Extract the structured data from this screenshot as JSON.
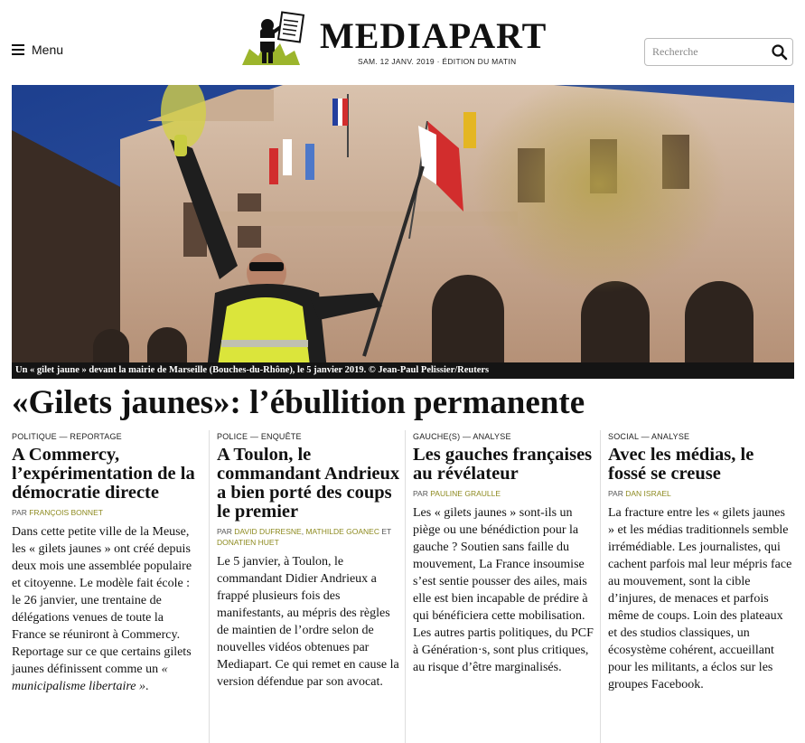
{
  "header": {
    "menu_label": "Menu",
    "logo_text": "MEDIAPART",
    "date_line": "SAM. 12 JANV. 2019 · ÉDITION DU MATIN",
    "search_placeholder": "Recherche"
  },
  "hero": {
    "caption": "Un « gilet jaune » devant la mairie de Marseille (Bouches-du-Rhône), le 5 janvier 2019. © Jean-Paul Pelissier/Reuters"
  },
  "headline": "«Gilets jaunes»: l’ébullition permanente",
  "articles": [
    {
      "rubric": "POLITIQUE — REPORTAGE",
      "title": "A Commercy, l’expérimentation de la démocratie directe",
      "by": "PAR",
      "authors": [
        "FRANÇOIS BONNET"
      ],
      "body": "Dans cette petite ville de la Meuse, les « gilets jaunes » ont créé depuis deux mois une assemblée populaire et citoyenne. Le modèle fait école : le 26 janvier, une trentaine de délégations venues de toute la France se réuniront à Commercy. Reportage sur ce que certains gilets jaunes définissent comme un",
      "body_em": "« municipalisme libertaire »",
      "body_end": "."
    },
    {
      "rubric": "POLICE — ENQUÊTE",
      "title": "A Toulon, le commandant Andrieux a bien porté des coups le premier",
      "by": "PAR",
      "authors": [
        "DAVID DUFRESNE",
        "MATHILDE GOANEC",
        "DONATIEN HUET"
      ],
      "sep1": ", ",
      "sep2": " ET ",
      "body": "Le 5 janvier, à Toulon, le commandant Didier Andrieux a frappé plusieurs fois des manifestants, au mépris des règles de maintien de l’ordre selon de nouvelles vidéos obtenues par Mediapart. Ce qui remet en cause la version défendue par son avocat."
    },
    {
      "rubric": "GAUCHE(S) — ANALYSE",
      "title": "Les gauches françaises au révélateur",
      "by": "PAR",
      "authors": [
        "PAULINE GRAULLE"
      ],
      "body": "Les « gilets jaunes » sont-ils un piège ou une bénédiction pour la gauche ? Soutien sans faille du mouvement, La France insoumise s’est sentie pousser des ailes, mais elle est bien incapable de prédire à qui bénéficiera cette mobilisation. Les autres partis politiques, du PCF à Génération·s, sont plus critiques, au risque d’être marginalisés."
    },
    {
      "rubric": "SOCIAL — ANALYSE",
      "title": "Avec les médias, le fossé se creuse",
      "by": "PAR",
      "authors": [
        "DAN ISRAEL"
      ],
      "body": "La fracture entre les « gilets jaunes » et les médias traditionnels semble irrémédiable. Les journalistes, qui cachent parfois mal leur mépris face au mouvement, sont la cible d’injures, de menaces et parfois même de coups. Loin des plateaux et des studios classiques, un écosystème cohérent, accueillant pour les militants, a éclos sur les groupes Facebook."
    }
  ],
  "colors": {
    "author": "#8d8a1f",
    "caption_bg": "#141414",
    "logo_green": "#9cb52c"
  }
}
